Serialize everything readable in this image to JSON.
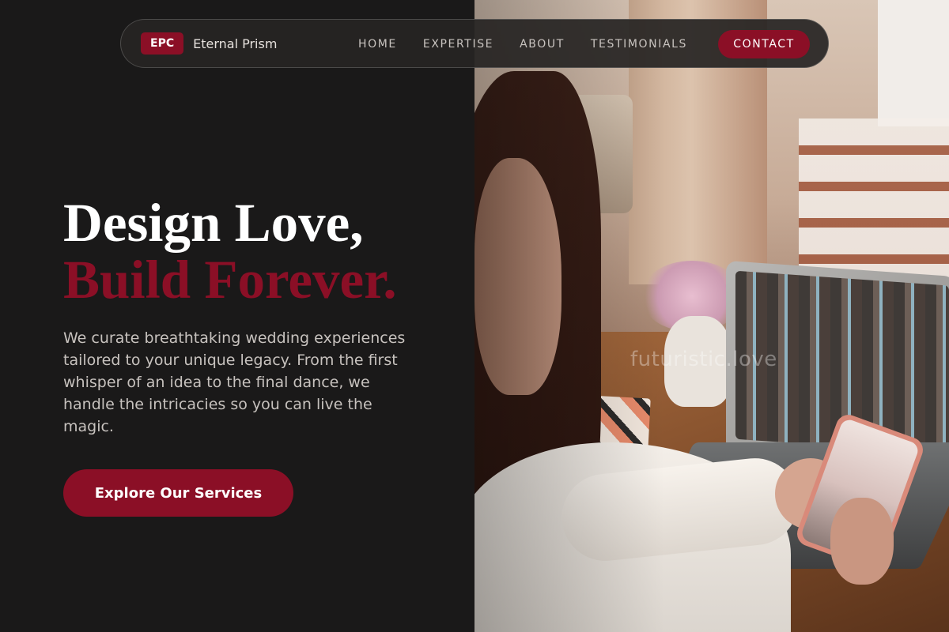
{
  "brand": {
    "badge": "EPC",
    "name": "Eternal Prism"
  },
  "nav": {
    "links": [
      "HOME",
      "EXPERTISE",
      "ABOUT",
      "TESTIMONIALS"
    ],
    "contact_label": "CONTACT"
  },
  "hero": {
    "title_line1": "Design Love,",
    "title_line2": "Build Forever.",
    "description": "We curate breathtaking wedding experiences tailored to your unique legacy. From the first whisper of an idea to the final dance, we handle the intricacies so you can live the magic.",
    "cta_label": "Explore Our Services"
  },
  "image": {
    "watermark": "futuristic.love"
  },
  "colors": {
    "accent": "#8b0f26",
    "background": "#1a1919",
    "nav_bg": "#262423"
  }
}
